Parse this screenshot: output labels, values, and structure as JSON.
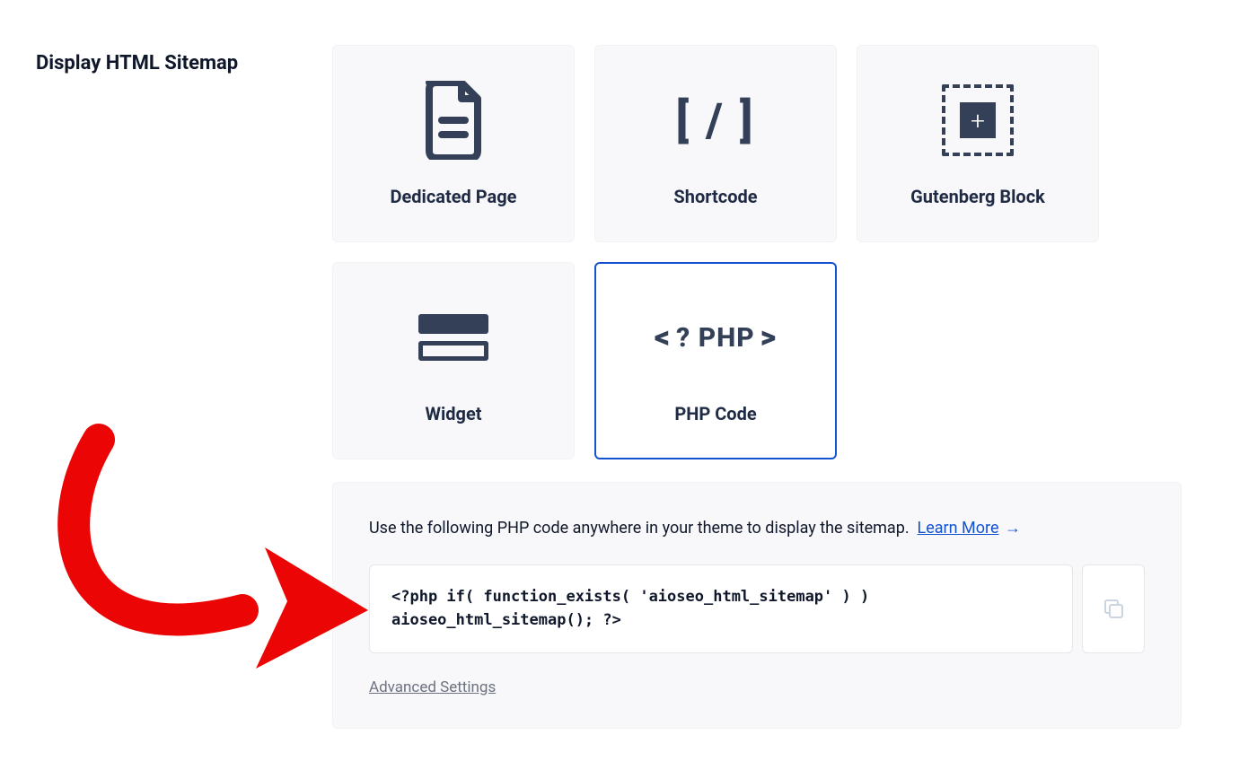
{
  "section_title": "Display HTML Sitemap",
  "cards": {
    "dedicated_page": {
      "label": "Dedicated Page"
    },
    "shortcode": {
      "label": "Shortcode",
      "icon_text": "[ / ]"
    },
    "gutenberg": {
      "label": "Gutenberg Block"
    },
    "widget": {
      "label": "Widget"
    },
    "php_code": {
      "label": "PHP Code",
      "icon_text": "? PHP"
    }
  },
  "panel": {
    "help_text": "Use the following PHP code anywhere in your theme to display the sitemap.",
    "learn_more": "Learn More",
    "code_snippet": "<?php if( function_exists( 'aioseo_html_sitemap' ) ) aioseo_html_sitemap(); ?>",
    "advanced_settings": "Advanced Settings"
  }
}
